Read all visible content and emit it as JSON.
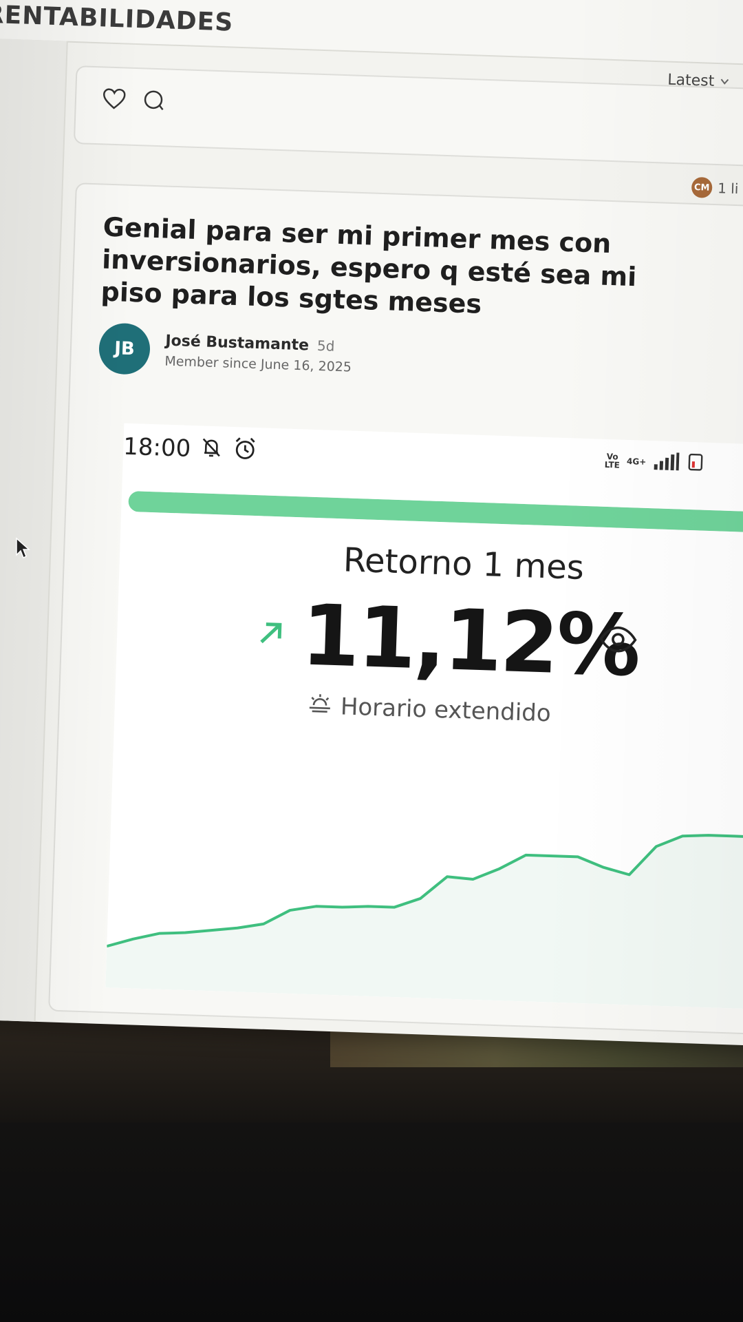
{
  "forum": {
    "title": "RENTABILIDADES",
    "sort_label": "Latest"
  },
  "previous_post": {
    "reply_avatar_initials": "CM",
    "replies_text": "1 li"
  },
  "post": {
    "title": "Genial para ser mi primer mes con inversionarios, espero q esté sea mi piso para los sgtes meses",
    "author": {
      "initials": "JB",
      "name": "José Bustamante",
      "age": "5d",
      "member_since": "Member since June 16, 2025"
    }
  },
  "embedded_screenshot": {
    "status_bar": {
      "time": "18:00",
      "network_left": "Vo\nLTE",
      "network_right": "4G+"
    },
    "progress_fraction": 1.0,
    "metric_label": "Retorno 1 mes",
    "metric_value": "11,12%",
    "session_label": "Horario extendido"
  },
  "chart_data": {
    "type": "area",
    "x": [
      0,
      1,
      2,
      3,
      4,
      5,
      6,
      7,
      8,
      9,
      10,
      11,
      12,
      13,
      14,
      15,
      16,
      17,
      18,
      19,
      20,
      21,
      22,
      23,
      24,
      25,
      26,
      27
    ],
    "values": [
      0.0,
      0.5,
      0.9,
      1.0,
      1.2,
      1.4,
      1.7,
      2.6,
      2.9,
      2.9,
      3.0,
      3.0,
      3.6,
      5.0,
      4.9,
      5.6,
      6.5,
      6.5,
      6.5,
      5.9,
      5.5,
      7.3,
      8.0,
      8.1,
      8.1,
      8.1,
      7.9,
      7.9
    ],
    "series_color": "#3fbf7f",
    "fill_color": "#f1f8f4",
    "grid": false
  },
  "colors": {
    "accent_green": "#3fbf7f",
    "avatar_teal": "#1f6f78"
  },
  "icons": {
    "like": "heart-icon",
    "comment": "comment-icon",
    "silent": "bell-off-icon",
    "alarm": "alarm-icon",
    "trend": "arrow-up-right-icon",
    "visibility": "eye-icon",
    "session": "sunrise-icon",
    "cursor": "mouse-pointer-icon"
  }
}
